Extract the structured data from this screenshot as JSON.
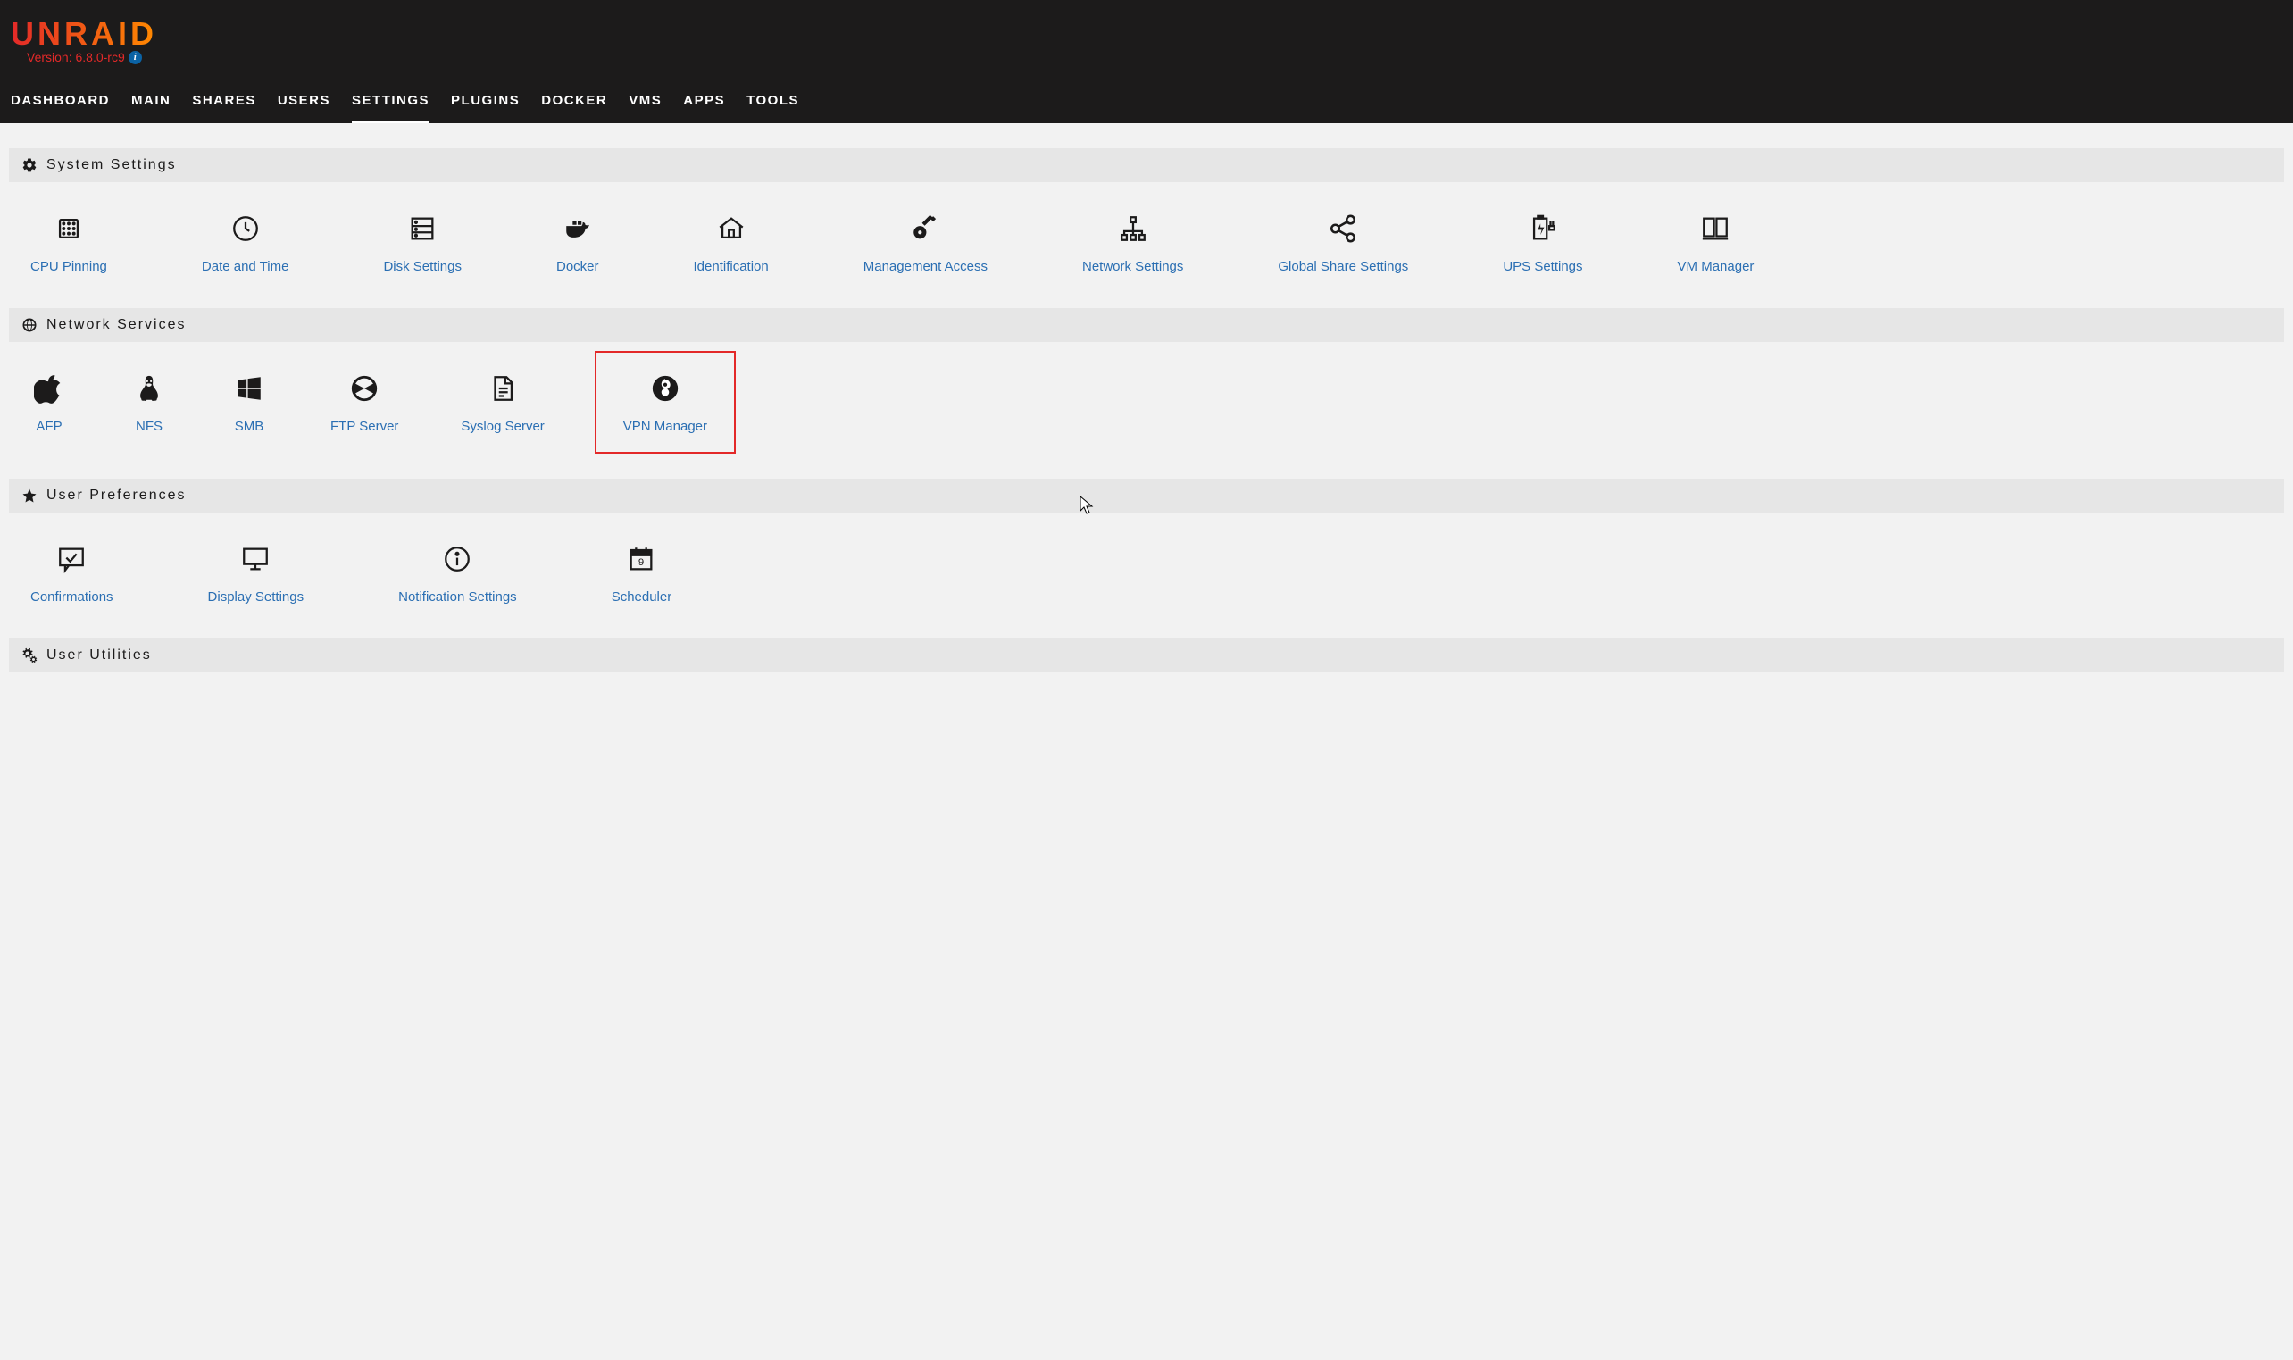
{
  "brand": "UNRAID",
  "version": "Version: 6.8.0-rc9",
  "nav": {
    "dashboard": "DASHBOARD",
    "main": "MAIN",
    "shares": "SHARES",
    "users": "USERS",
    "settings": "SETTINGS",
    "plugins": "PLUGINS",
    "docker": "DOCKER",
    "vms": "VMS",
    "apps": "APPS",
    "tools": "TOOLS"
  },
  "sections": {
    "system": "System Settings",
    "network": "Network Services",
    "prefs": "User Preferences",
    "util": "User Utilities"
  },
  "system_tiles": {
    "cpu": "CPU Pinning",
    "date": "Date and Time",
    "disk": "Disk Settings",
    "docker": "Docker",
    "ident": "Identification",
    "mgmt": "Management Access",
    "net": "Network Settings",
    "gshare": "Global Share Settings",
    "ups": "UPS Settings",
    "vm": "VM Manager"
  },
  "network_tiles": {
    "afp": "AFP",
    "nfs": "NFS",
    "smb": "SMB",
    "ftp": "FTP Server",
    "syslog": "Syslog Server",
    "vpn": "VPN Manager"
  },
  "pref_tiles": {
    "confirm": "Confirmations",
    "display": "Display Settings",
    "notif": "Notification Settings",
    "sched": "Scheduler"
  }
}
